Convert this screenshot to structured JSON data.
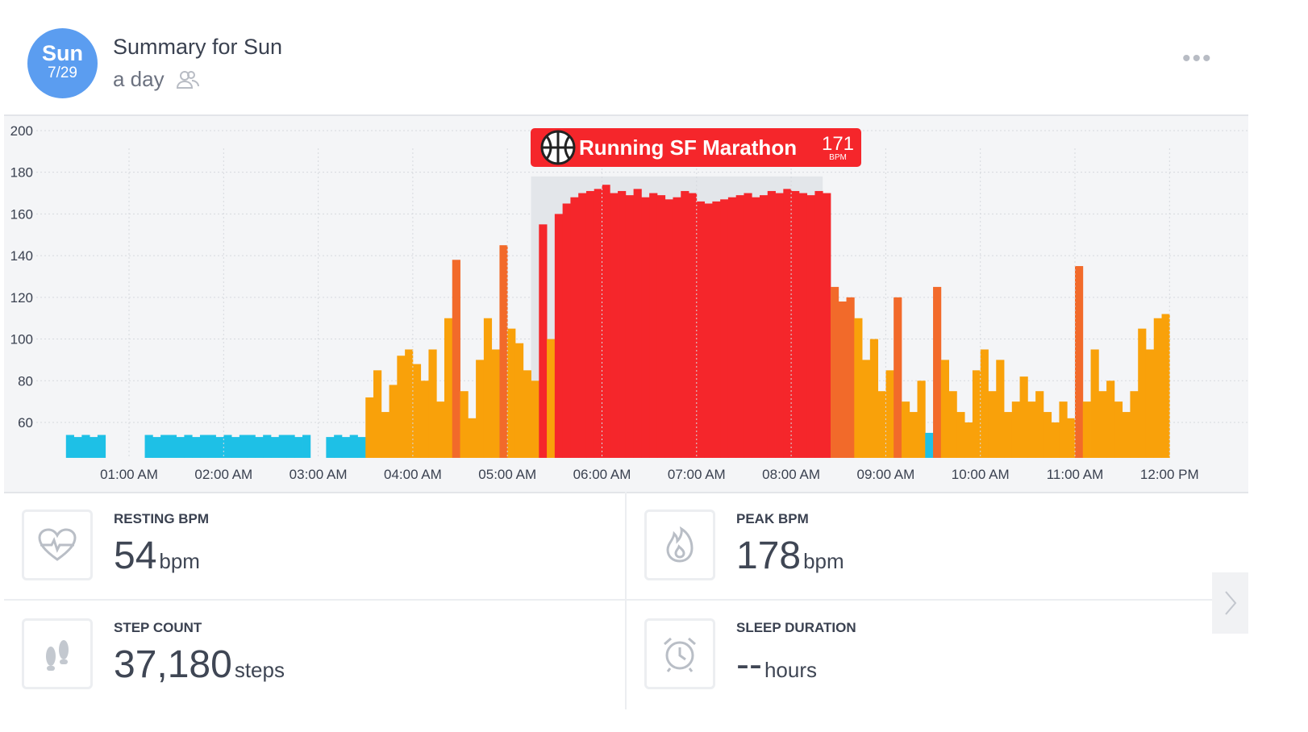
{
  "header": {
    "day": "Sun",
    "date": "7/29",
    "title": "Summary for Sun",
    "subtitle": "a day",
    "icons": [
      "people-icon",
      "more-icon"
    ]
  },
  "colors": {
    "rest": "#1ec0e6",
    "light": "#f9a10a",
    "moderate": "#f26a2a",
    "peak": "#f5262b",
    "avatar": "#5b9df0"
  },
  "chart_data": {
    "type": "bar",
    "ylim": [
      43,
      200
    ],
    "yticks": [
      60,
      80,
      100,
      120,
      140,
      160,
      180,
      200
    ],
    "xticks": [
      "01:00 AM",
      "02:00 AM",
      "03:00 AM",
      "04:00 AM",
      "05:00 AM",
      "06:00 AM",
      "07:00 AM",
      "08:00 AM",
      "09:00 AM",
      "10:00 AM",
      "11:00 AM",
      "12:00 PM"
    ],
    "grid": true,
    "x_start": "00:20",
    "x_step_minutes": 5,
    "values": [
      54,
      53,
      54,
      53,
      54,
      null,
      null,
      null,
      null,
      null,
      54,
      53,
      54,
      54,
      53,
      54,
      53,
      54,
      54,
      53,
      54,
      53,
      54,
      54,
      53,
      54,
      53,
      54,
      54,
      53,
      54,
      null,
      null,
      53,
      54,
      53,
      54,
      53,
      72,
      85,
      65,
      78,
      92,
      95,
      88,
      80,
      95,
      70,
      110,
      138,
      75,
      62,
      90,
      110,
      95,
      145,
      105,
      98,
      85,
      80,
      155,
      100,
      160,
      165,
      168,
      170,
      171,
      172,
      174,
      170,
      171,
      169,
      172,
      168,
      170,
      169,
      167,
      168,
      171,
      170,
      166,
      165,
      166,
      167,
      168,
      169,
      170,
      168,
      169,
      171,
      170,
      172,
      171,
      170,
      169,
      171,
      170,
      125,
      118,
      120,
      110,
      90,
      100,
      75,
      85,
      120,
      70,
      65,
      80,
      55,
      125,
      90,
      75,
      65,
      60,
      85,
      95,
      75,
      90,
      65,
      70,
      82,
      70,
      75,
      65,
      60,
      70,
      62,
      135,
      70,
      95,
      75,
      80,
      70,
      65,
      75,
      105,
      95,
      110,
      112
    ],
    "event": {
      "label": "Running SF Marathon",
      "value": "171",
      "unit": "BPM",
      "icon": "basketball-icon",
      "start": "05:15",
      "end": "08:20"
    }
  },
  "stats": [
    {
      "label": "RESTING BPM",
      "value": "54",
      "unit": "bpm",
      "icon": "heart-pulse-icon"
    },
    {
      "label": "PEAK BPM",
      "value": "178",
      "unit": "bpm",
      "icon": "flame-icon"
    },
    {
      "label": "STEP COUNT",
      "value": "37,180",
      "unit": "steps",
      "icon": "footprints-icon"
    },
    {
      "label": "SLEEP DURATION",
      "value": "--",
      "unit": "hours",
      "icon": "alarm-clock-icon"
    }
  ]
}
